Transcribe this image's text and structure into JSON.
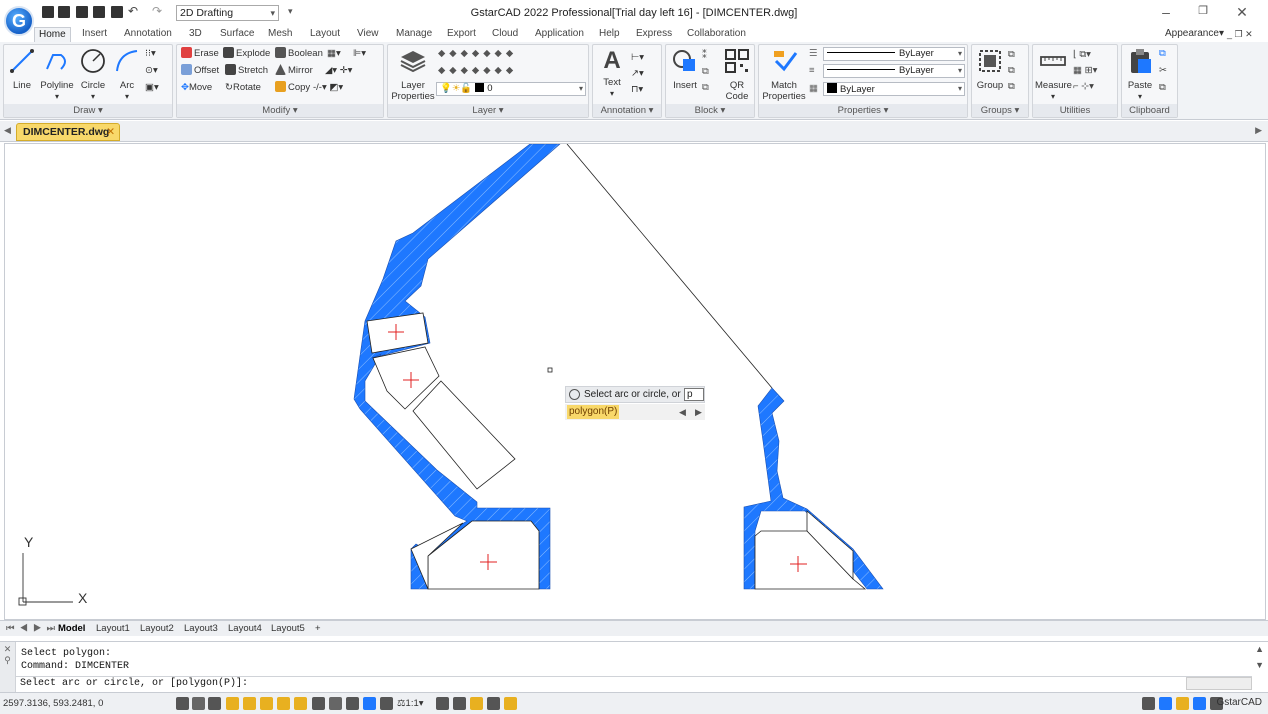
{
  "window": {
    "title": "GstarCAD 2022 Professional[Trial day left 16] - [DIMCENTER.dwg]",
    "workspace": "2D Drafting",
    "logo": "G",
    "appearance_label": "Appearance"
  },
  "menu_tabs": [
    "Home",
    "Insert",
    "Annotation",
    "3D",
    "Surface",
    "Mesh",
    "Layout",
    "View",
    "Manage",
    "Export",
    "Cloud",
    "Application",
    "Help",
    "Express",
    "Collaboration"
  ],
  "ribbon": {
    "draw": {
      "title": "Draw",
      "line": "Line",
      "polyline": "Polyline",
      "circle": "Circle",
      "arc": "Arc"
    },
    "modify": {
      "title": "Modify",
      "erase": "Erase",
      "explode": "Explode",
      "boolean": "Boolean",
      "offset": "Offset",
      "stretch": "Stretch",
      "mirror": "Mirror",
      "move": "Move",
      "rotate": "Rotate",
      "copy": "Copy"
    },
    "layer": {
      "title": "Layer",
      "layer_properties": "Layer Properties",
      "current_layer": "0"
    },
    "annotation": {
      "title": "Annotation",
      "text": "Text"
    },
    "block": {
      "title": "Block",
      "insert": "Insert",
      "qr_code": "QR Code"
    },
    "properties": {
      "title": "Properties",
      "match_properties": "Match Properties",
      "linetype": "ByLayer",
      "lineweight": "ByLayer",
      "color": "ByLayer"
    },
    "groups": {
      "title": "Groups",
      "group": "Group"
    },
    "utilities": {
      "title": "Utilities",
      "measure": "Measure"
    },
    "clipboard": {
      "title": "Clipboard",
      "paste": "Paste"
    }
  },
  "document_tab": "DIMCENTER.dwg",
  "prompt": {
    "text": "Select arc or circle, or",
    "input": "p",
    "option": "polygon(P)"
  },
  "axes": {
    "y": "Y",
    "x": "X"
  },
  "layout_tabs": [
    "Model",
    "Layout1",
    "Layout2",
    "Layout3",
    "Layout4",
    "Layout5",
    "+"
  ],
  "command_history": [
    "Select polygon:",
    "Command: DIMCENTER"
  ],
  "command_input": "Select arc or circle, or [polygon(P)]:",
  "status": {
    "coords": "2597.3136, 593.2481, 0",
    "scale": "1:1",
    "app": "GstarCAD"
  },
  "colors": {
    "accent": "#1e78ff",
    "hatch": "#1e78ff",
    "centermark": "#e02020",
    "tab_active": "#f8d86a"
  }
}
